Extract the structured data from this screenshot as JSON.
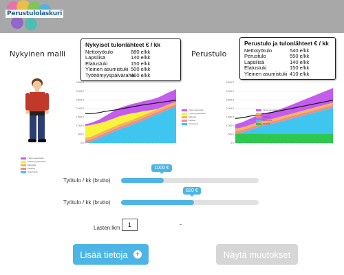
{
  "header": {
    "logo_text": "Perustulolaskuri"
  },
  "left_panel": {
    "heading": "Nykyinen malli"
  },
  "right_panel": {
    "heading": "Perustulo"
  },
  "left_info": {
    "title": "Nykyiset tulonlähteet € / kk",
    "rows": [
      {
        "label": "Nettotyötulo",
        "value": "880 e/kk"
      },
      {
        "label": "Lapsilisä",
        "value": "140 e/kk"
      },
      {
        "label": "Elatustuki",
        "value": "150 e/kk"
      },
      {
        "label": "Yleinen asumistuki",
        "value": "500 e/kk"
      },
      {
        "label": "Työttömyyspäiväraha",
        "value": "460 e/kk"
      }
    ]
  },
  "right_info": {
    "title": "Perustulo ja tulonlähteet € / kk",
    "rows": [
      {
        "label": "Nettotyötulo",
        "value": "540 e/kk"
      },
      {
        "label": "Perustulo",
        "value": "550 e/kk"
      },
      {
        "label": "Lapsilisä",
        "value": "140 e/kk"
      },
      {
        "label": "Elatustuki",
        "value": "150 e/kk"
      },
      {
        "label": "Yleinen asumistuki",
        "value": "410 e/kk"
      }
    ]
  },
  "colors": {
    "accent": "#4db5e6",
    "housing": "#c45ced",
    "unemployment": "#f7f23a",
    "basic_income": "#2ec84f",
    "child_benefit": "#f08a8a",
    "maintenance": "#f5b35e",
    "net_income": "#3ec6f0",
    "total_line": "#111111"
  },
  "chart_data": [
    {
      "type": "area",
      "series": [
        {
          "name": "Nettotyötulo",
          "color": "#3ec6f0",
          "values": [
            0,
            60,
            180,
            300,
            420,
            540,
            660,
            780,
            880,
            980,
            1080,
            1180,
            1300,
            1420,
            1540,
            1660,
            1780,
            1900,
            2000,
            2100
          ]
        },
        {
          "name": "Lapsilisä",
          "color": "#f08a8a",
          "values": [
            140,
            140,
            140,
            140,
            140,
            140,
            140,
            140,
            140,
            140,
            140,
            140,
            140,
            140,
            140,
            140,
            140,
            140,
            140,
            140
          ]
        },
        {
          "name": "Elatustuki",
          "color": "#f5b35e",
          "values": [
            150,
            150,
            150,
            150,
            150,
            150,
            150,
            150,
            150,
            150,
            150,
            150,
            150,
            150,
            150,
            150,
            150,
            150,
            150,
            150
          ]
        },
        {
          "name": "Työttömyyspäiväraha",
          "color": "#f7f23a",
          "values": [
            700,
            680,
            620,
            560,
            520,
            490,
            470,
            460,
            440,
            400,
            360,
            300,
            240,
            160,
            80,
            20,
            0,
            0,
            0,
            0
          ]
        },
        {
          "name": "Yleinen asumistuki",
          "color": "#c45ced",
          "values": [
            100,
            120,
            160,
            220,
            300,
            380,
            440,
            480,
            500,
            520,
            540,
            560,
            580,
            600,
            620,
            640,
            660,
            680,
            700,
            720
          ]
        }
      ],
      "total": [
        1700,
        1700,
        1720,
        1760,
        1820,
        1860,
        1900,
        1950,
        2000,
        2050,
        2100,
        2150,
        2200,
        2240,
        2280,
        2320,
        2360,
        2400,
        2440,
        2480
      ],
      "ylim": [
        0,
        3500
      ],
      "yticks": [
        "0 €",
        "500 €",
        "1 000 €",
        "1 500 €",
        "2 000 €",
        "2 500 €",
        "3 000 €",
        "3 500 €"
      ]
    },
    {
      "type": "area",
      "series": [
        {
          "name": "Perustulo",
          "color": "#2ec84f",
          "values": [
            550,
            550,
            550,
            550,
            550,
            550,
            550,
            550,
            550,
            550,
            550,
            550,
            550,
            550,
            550,
            550,
            550,
            550,
            550,
            550
          ]
        },
        {
          "name": "Nettotyötulo",
          "color": "#3ec6f0",
          "values": [
            0,
            40,
            120,
            220,
            320,
            420,
            500,
            540,
            620,
            700,
            780,
            860,
            940,
            1020,
            1100,
            1180,
            1260,
            1340,
            1420,
            1500
          ]
        },
        {
          "name": "Lapsilisä",
          "color": "#f08a8a",
          "values": [
            140,
            140,
            140,
            140,
            140,
            140,
            140,
            140,
            140,
            140,
            140,
            140,
            140,
            140,
            140,
            140,
            140,
            140,
            140,
            140
          ]
        },
        {
          "name": "Elatustuki",
          "color": "#f5b35e",
          "values": [
            150,
            150,
            150,
            150,
            150,
            150,
            150,
            150,
            150,
            150,
            150,
            150,
            150,
            150,
            150,
            150,
            150,
            150,
            150,
            150
          ]
        },
        {
          "name": "Yleinen asumistuki",
          "color": "#c45ced",
          "values": [
            250,
            280,
            330,
            360,
            390,
            400,
            410,
            410,
            430,
            450,
            480,
            520,
            560,
            600,
            640,
            680,
            720,
            760,
            800,
            840
          ]
        }
      ],
      "total": [
        1420,
        1450,
        1500,
        1560,
        1620,
        1680,
        1720,
        1760,
        1820,
        1880,
        1940,
        2000,
        2060,
        2120,
        2180,
        2240,
        2300,
        2360,
        2420,
        2480
      ],
      "ylim": [
        0,
        3500
      ],
      "yticks": [
        "0 €",
        "500 €",
        "1 000 €",
        "1 500 €",
        "2 000 €",
        "2 500 €",
        "3 000 €",
        "3 500 €"
      ]
    }
  ],
  "slider1": {
    "label": "Työtulo / kk (brutto)",
    "value": "1000 €",
    "fraction": 0.31
  },
  "slider2": {
    "label": "Työtulo / kk (brutto)",
    "value": "820 €",
    "fraction": 0.53
  },
  "children": {
    "label": "Lasten lkm",
    "value": "1"
  },
  "buttons": {
    "add": "Lisää tietoja",
    "add_icon": "+",
    "show": "Näytä muutokset"
  }
}
